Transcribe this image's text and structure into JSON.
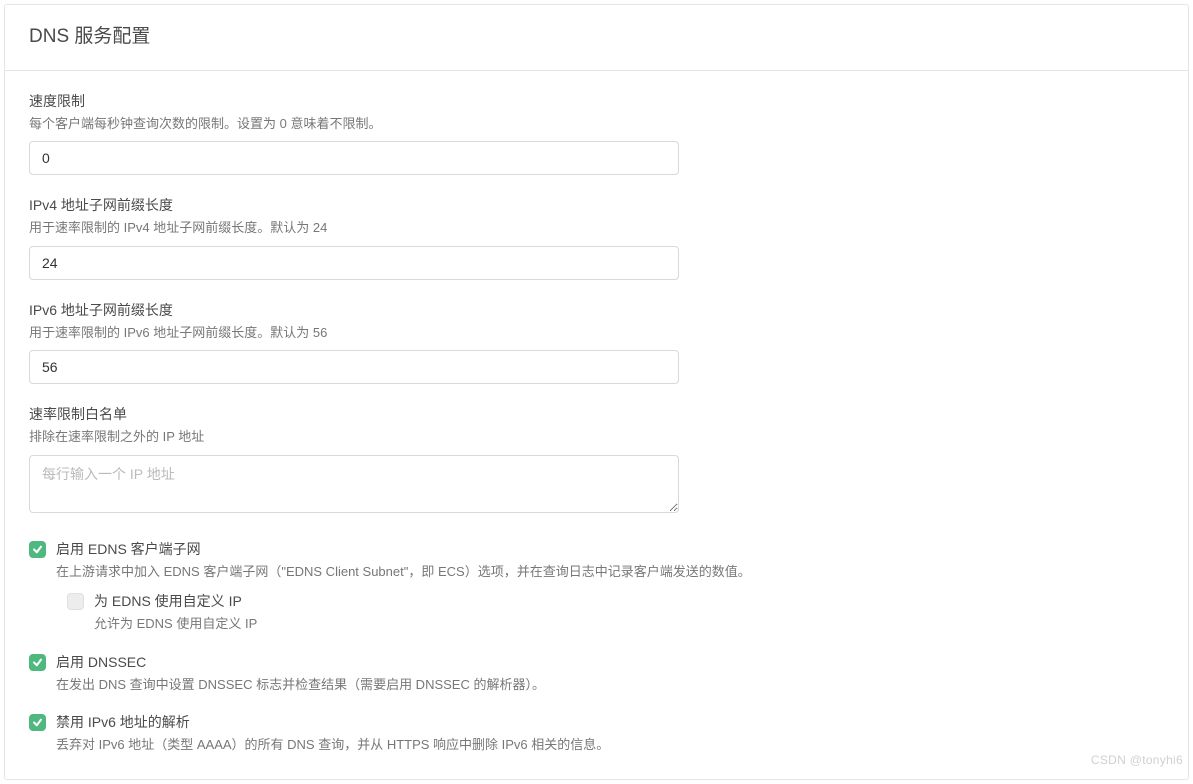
{
  "header": {
    "title": "DNS 服务配置"
  },
  "fields": {
    "rate_limit": {
      "label": "速度限制",
      "desc": "每个客户端每秒钟查询次数的限制。设置为 0 意味着不限制。",
      "value": "0"
    },
    "ipv4_prefix": {
      "label": "IPv4 地址子网前缀长度",
      "desc": "用于速率限制的 IPv4 地址子网前缀长度。默认为 24",
      "value": "24"
    },
    "ipv6_prefix": {
      "label": "IPv6 地址子网前缀长度",
      "desc": "用于速率限制的 IPv6 地址子网前缀长度。默认为 56",
      "value": "56"
    },
    "whitelist": {
      "label": "速率限制白名单",
      "desc": "排除在速率限制之外的 IP 地址",
      "placeholder": "每行输入一个 IP 地址",
      "value": ""
    }
  },
  "checks": {
    "edns": {
      "label": "启用 EDNS 客户端子网",
      "desc": "在上游请求中加入 EDNS 客户端子网（\"EDNS Client Subnet\"，即 ECS）选项，并在查询日志中记录客户端发送的数值。"
    },
    "edns_custom": {
      "label": "为 EDNS 使用自定义 IP",
      "desc": "允许为 EDNS 使用自定义 IP"
    },
    "dnssec": {
      "label": "启用 DNSSEC",
      "desc": "在发出 DNS 查询中设置 DNSSEC 标志并检查结果（需要启用 DNSSEC 的解析器）。"
    },
    "disable_ipv6": {
      "label": "禁用 IPv6 地址的解析",
      "desc": "丢弃对 IPv6 地址（类型 AAAA）的所有 DNS 查询，并从 HTTPS 响应中删除 IPv6 相关的信息。"
    }
  },
  "watermark": "CSDN @tonyhi6"
}
